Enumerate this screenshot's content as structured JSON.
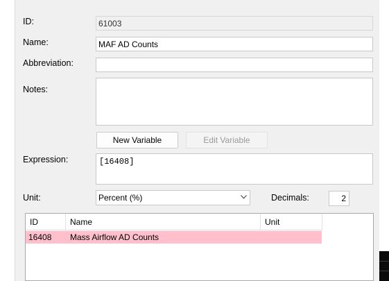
{
  "form": {
    "id_label": "ID:",
    "id_value": "61003",
    "name_label": "Name:",
    "name_value": "MAF AD Counts",
    "abbreviation_label": "Abbreviation:",
    "abbreviation_value": "",
    "notes_label": "Notes:",
    "notes_value": "",
    "new_variable_label": "New Variable",
    "edit_variable_label": "Edit Variable",
    "expression_label": "Expression:",
    "expression_value": "[16408]",
    "unit_label": "Unit:",
    "unit_value": "Percent (%)",
    "decimals_label": "Decimals:",
    "decimals_value": "2"
  },
  "variables_table": {
    "columns": [
      "ID",
      "Name",
      "Unit"
    ],
    "rows": [
      {
        "id": "16408",
        "name": "Mass Airflow AD Counts",
        "unit": ""
      }
    ],
    "highlight_color": "#ffc0cb"
  },
  "icons": [
    "chevron-down-icon"
  ]
}
